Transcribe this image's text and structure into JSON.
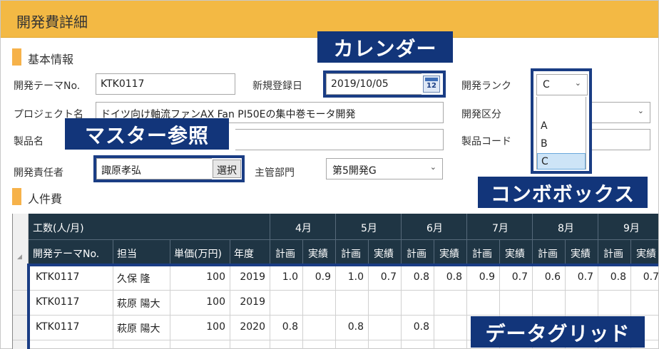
{
  "window_title": "開発費詳細",
  "sections": {
    "basic": "基本情報",
    "personnel": "人件費"
  },
  "form": {
    "theme_no_label": "開発テーマNo.",
    "theme_no_value": "KTK0117",
    "reg_date_label": "新規登録日",
    "reg_date_value": "2019/10/05",
    "calendar_day": "12",
    "rank_label": "開発ランク",
    "rank_value": "C",
    "project_label": "プロジェクト名",
    "project_value": "ドイツ向け軸流ファンAX Fan PI50Eの集中巻モータ開発",
    "category_label": "開発区分",
    "product_label": "製品名",
    "product_code_label": "製品コード",
    "owner_label": "開発責任者",
    "owner_value": "諏原孝弘",
    "select_button": "選択",
    "dept_label": "主管部門",
    "dept_value": "第5開発G"
  },
  "rank_options": [
    "A",
    "B",
    "C"
  ],
  "callouts": {
    "calendar": "カレンダー",
    "master": "マスター参照",
    "combo": "コンボボックス",
    "grid": "データグリッド"
  },
  "grid": {
    "group_header": "工数(人/月)",
    "months": [
      "4月",
      "5月",
      "6月",
      "7月",
      "8月",
      "9月"
    ],
    "columns": {
      "theme": "開発テーマNo.",
      "person": "担当",
      "unit": "単価(万円)",
      "year": "年度",
      "plan": "計画",
      "actual": "実績"
    },
    "rows": [
      {
        "theme": "KTK0117",
        "person": "久保 隆",
        "unit": "100",
        "year": "2019",
        "vals": [
          "1.0",
          "0.9",
          "1.0",
          "0.7",
          "0.8",
          "0.8",
          "0.9",
          "0.7",
          "0.6",
          "0.7",
          "0.8",
          "0.7"
        ]
      },
      {
        "theme": "KTK0117",
        "person": "萩原 陽大",
        "unit": "100",
        "year": "2019",
        "vals": [
          "",
          "",
          "",
          "",
          "",
          "",
          "",
          "",
          "",
          "",
          "",
          ""
        ]
      },
      {
        "theme": "KTK0117",
        "person": "萩原 陽大",
        "unit": "100",
        "year": "2020",
        "vals": [
          "0.8",
          "",
          "0.8",
          "",
          "0.8",
          "",
          "",
          "",
          "",
          "",
          "",
          ""
        ]
      }
    ]
  },
  "icons": {
    "dropdown": "chevron-down-icon",
    "calendar": "calendar-icon",
    "sort": "sort-triangle-icon"
  }
}
